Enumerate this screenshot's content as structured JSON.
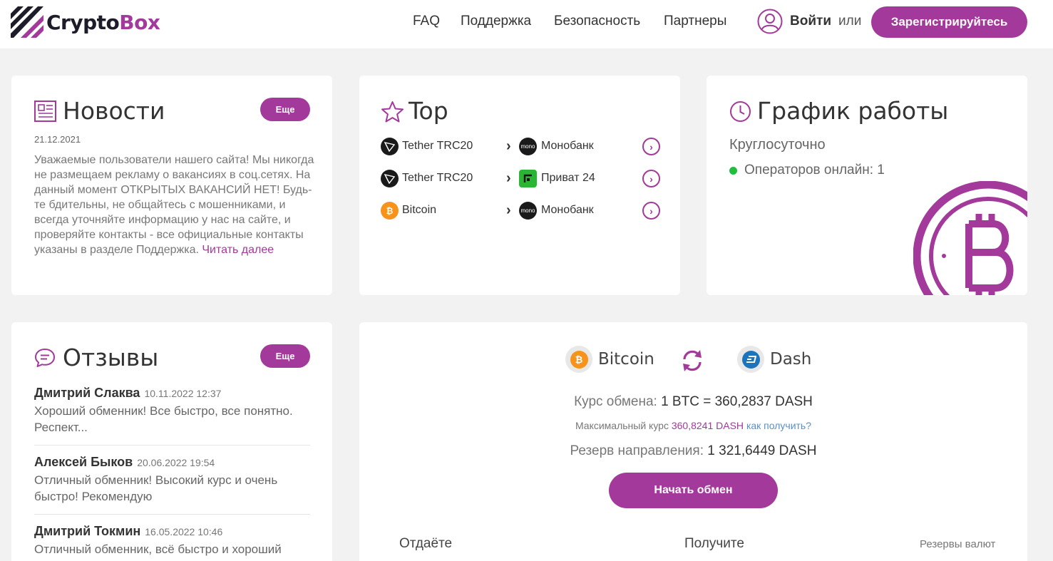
{
  "header": {
    "logo_part1": "Crypto",
    "logo_part2": "Box",
    "nav": [
      "FAQ",
      "Поддержка",
      "Безопасность",
      "Партнеры"
    ],
    "login": "Войти",
    "or": "или",
    "register": "Зарегистрируйтесь"
  },
  "news": {
    "title": "Новости",
    "more": "Еще",
    "date": "21.12.2021",
    "text": "Уважаемые пользователи нашего сайта! Мы никогда не размещаем рекламу о вакансиях в соц.сетях. На данный момент ОТКРЫТЫХ ВАКАНСИЙ НЕТ! Будь-те бдительны, не общайтесь с мошенниками, и всегда уточняйте информацию у нас на сайте, и проверяйте контакты - все официальные контакты указаны в разделе Поддержка.",
    "read_more": "Читать далее"
  },
  "top": {
    "title": "Top",
    "rows": [
      {
        "from": "Tether TRC20",
        "from_icon": "tron-icon",
        "to": "Монобанк",
        "to_icon": "monobank-icon"
      },
      {
        "from": "Tether TRC20",
        "from_icon": "tron-icon",
        "to": "Приват 24",
        "to_icon": "privat24-icon"
      },
      {
        "from": "Bitcoin",
        "from_icon": "bitcoin-icon",
        "to": "Монобанк",
        "to_icon": "monobank-icon"
      }
    ],
    "arrow": "›",
    "mono_badge": "mono"
  },
  "schedule": {
    "title": "График работы",
    "hours": "Круглосуточно",
    "operators": "Операторов онлайн: 1"
  },
  "reviews": {
    "title": "Отзывы",
    "more": "Еще",
    "items": [
      {
        "author": "Дмитрий Слаква",
        "date": "10.11.2022 12:37",
        "text": "Хороший обменник! Все быстро, все понятно. Респект..."
      },
      {
        "author": "Алексей Быков",
        "date": "20.06.2022 19:54",
        "text": "Отличный обменник! Высокий курс и очень быстро! Рекомендую"
      },
      {
        "author": "Дмитрий Токмин",
        "date": "16.05.2022 10:46",
        "text": "Отличный обменник, всё быстро и хороший"
      }
    ]
  },
  "exchange": {
    "from": "Bitcoin",
    "to": "Dash",
    "rate_label": "Курс обмена:",
    "rate_value": "1 BTC = 360,2837 DASH",
    "max_label": "Максимальный курс",
    "max_value": "360,8241 DASH",
    "max_link": "как получить?",
    "reserve_label": "Резерв направления:",
    "reserve_value": "1 321,6449 DASH",
    "start": "Начать обмен",
    "col_give": "Отдаёте",
    "col_get": "Получите",
    "col_reserves": "Резервы валют"
  },
  "colors": {
    "accent": "#a2399b",
    "online": "#1fbe3c",
    "link": "#5a8fc7"
  }
}
